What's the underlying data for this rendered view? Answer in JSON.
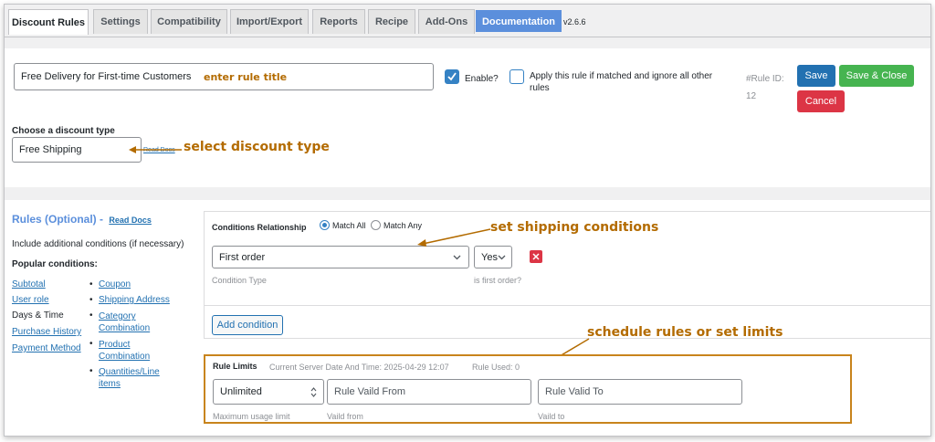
{
  "tabs": [
    {
      "label": "Discount Rules"
    },
    {
      "label": "Settings"
    },
    {
      "label": "Compatibility"
    },
    {
      "label": "Import/Export"
    },
    {
      "label": "Reports"
    },
    {
      "label": "Recipe"
    },
    {
      "label": "Add-Ons"
    },
    {
      "label": "Documentation"
    }
  ],
  "version": "v2.6.6",
  "rule": {
    "title_value": "Free Delivery for First-time Customers",
    "enable_label": "Enable?",
    "apply_label": "Apply this rule if matched and ignore all other rules",
    "rule_id_label": "#Rule ID:",
    "rule_id_value": "12",
    "save_label": "Save",
    "save_close_label": "Save & Close",
    "cancel_label": "Cancel"
  },
  "discount": {
    "heading": "Choose a discount type",
    "selected": "Free Shipping",
    "read_docs": "Read Docs"
  },
  "rules_sidebar": {
    "title": "Rules (Optional) -",
    "read_docs": "Read Docs",
    "subtitle": "Include additional conditions (if necessary)",
    "popular": "Popular conditions:",
    "col1": [
      "Subtotal",
      "User role",
      "Days & Time",
      "Purchase History",
      "Payment Method"
    ],
    "col2": [
      "Coupon",
      "Shipping Address",
      "Category Combination",
      "Product Combination",
      "Quantities/Line items"
    ]
  },
  "conditions": {
    "relationship_label": "Conditions Relationship",
    "match_all": "Match All",
    "match_any": "Match Any",
    "type_value": "First order",
    "type_hint": "Condition Type",
    "yes_value": "Yes",
    "yes_hint": "is first order?",
    "add_label": "Add condition"
  },
  "limits": {
    "title": "Rule Limits",
    "server_time": "Current Server Date And Time: 2025-04-29 12:07",
    "rule_used": "Rule Used: 0",
    "usage_value": "Unlimited",
    "usage_hint": "Maximum usage limit",
    "from_placeholder": "Rule Vaild From",
    "from_hint": "Vaild from",
    "to_placeholder": "Rule Valid To",
    "to_hint": "Vaild to"
  },
  "annotations": {
    "title": "enter rule title",
    "discount": "select discount type",
    "shipping": "set shipping conditions",
    "schedule": "schedule rules or set limits"
  },
  "colors": {
    "save": "#2271b1",
    "save_close": "#46b450",
    "cancel": "#dc3545",
    "annotation": "#b36b00",
    "link": "#2271b1"
  }
}
